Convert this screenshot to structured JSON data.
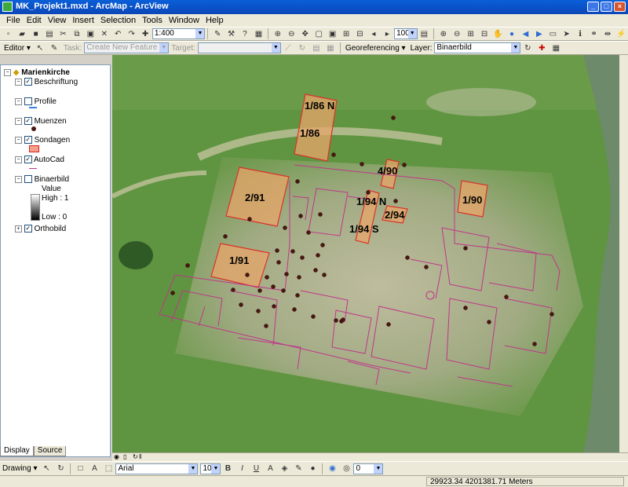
{
  "window": {
    "title": "MK_Projekt1.mxd - ArcMap - ArcView"
  },
  "menu": [
    "File",
    "Edit",
    "View",
    "Insert",
    "Selection",
    "Tools",
    "Window",
    "Help"
  ],
  "toolbar": {
    "scale": "1:400",
    "zoom_percent": "100%"
  },
  "editor_bar": {
    "editor_label": "Editor ▾",
    "task_label": "Task:",
    "task_value": "Create New Feature",
    "target_label": "Target:",
    "georef_label": "Georeferencing ▾",
    "layer_label": "Layer:",
    "layer_value": "Binaerbild"
  },
  "toc": {
    "root": "Marienkirche",
    "layers": [
      {
        "name": "Beschriftung",
        "checked": true
      },
      {
        "name": "Profile",
        "checked": false
      },
      {
        "name": "Muenzen",
        "checked": true
      },
      {
        "name": "Sondagen",
        "checked": true
      },
      {
        "name": "AutoCad",
        "checked": true
      },
      {
        "name": "Binaerbild",
        "checked": false
      },
      {
        "name": "Orthobild",
        "checked": true
      }
    ],
    "raster_value": "Value",
    "raster_high": "High : 1",
    "raster_low": "Low : 0",
    "tabs": [
      "Display",
      "Source"
    ]
  },
  "map": {
    "labels": [
      "1/86 N",
      "1/86",
      "4/90",
      "2/91",
      "1/94 N",
      "2/94",
      "1/94 S",
      "1/90",
      "1/91"
    ]
  },
  "drawing_bar": {
    "drawing_label": "Drawing ▾",
    "font": "Arial",
    "size": "10",
    "angle": "0"
  },
  "status": {
    "coordinates": "29923.34  4201381.71 Meters"
  },
  "colors": {
    "sondage_fill": "#e8a56a",
    "autocad_line": "#c0368a",
    "coin": "#4a1612"
  }
}
